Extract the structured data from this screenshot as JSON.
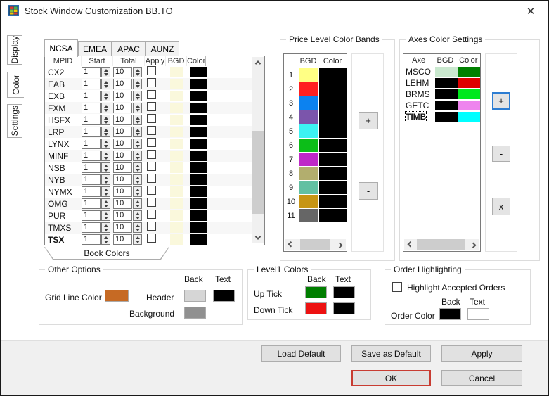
{
  "window": {
    "title": "Stock Window Customization BB.TO",
    "close_glyph": "✕"
  },
  "side_tabs": [
    {
      "label": "Display",
      "selected": false
    },
    {
      "label": "Color",
      "selected": true
    },
    {
      "label": "Settings",
      "selected": false
    }
  ],
  "region_tabs": [
    {
      "label": "NCSA",
      "selected": true
    },
    {
      "label": "EMEA",
      "selected": false
    },
    {
      "label": "APAC",
      "selected": false
    },
    {
      "label": "AUNZ",
      "selected": false
    }
  ],
  "book_table": {
    "headers": [
      "MPID",
      "Start",
      "Total",
      "Apply",
      "BGD",
      "Color"
    ],
    "row_defaults": {
      "start": "1",
      "total": "10",
      "apply": false,
      "bgd": "#FAF8DC",
      "color": "#000000"
    },
    "rows": [
      {
        "mpid": "CX2"
      },
      {
        "mpid": "EAB"
      },
      {
        "mpid": "EXB"
      },
      {
        "mpid": "FXM"
      },
      {
        "mpid": "HSFX"
      },
      {
        "mpid": "LRP"
      },
      {
        "mpid": "LYNX"
      },
      {
        "mpid": "MINF"
      },
      {
        "mpid": "NSB"
      },
      {
        "mpid": "NYB"
      },
      {
        "mpid": "NYMX"
      },
      {
        "mpid": "OMG"
      },
      {
        "mpid": "PUR"
      },
      {
        "mpid": "TMXS"
      },
      {
        "mpid": "TSX",
        "bold": true
      }
    ],
    "bottom_tab": "Book Colors"
  },
  "price_bands": {
    "title": "Price Level Color Bands",
    "headers": [
      "BGD",
      "Color"
    ],
    "rows": [
      {
        "n": "1",
        "bgd": "#FFFF84",
        "color": "#000000"
      },
      {
        "n": "2",
        "bgd": "#FF2020",
        "color": "#000000"
      },
      {
        "n": "3",
        "bgd": "#0C82F0",
        "color": "#000000"
      },
      {
        "n": "4",
        "bgd": "#7B55AB",
        "color": "#000000"
      },
      {
        "n": "5",
        "bgd": "#3CF2F2",
        "color": "#000000"
      },
      {
        "n": "6",
        "bgd": "#0CBE18",
        "color": "#000000"
      },
      {
        "n": "7",
        "bgd": "#BE29C8",
        "color": "#000000"
      },
      {
        "n": "8",
        "bgd": "#B2AE6E",
        "color": "#000000"
      },
      {
        "n": "9",
        "bgd": "#62C0A2",
        "color": "#000000"
      },
      {
        "n": "10",
        "bgd": "#C79514",
        "color": "#000000"
      },
      {
        "n": "11",
        "bgd": "#666666",
        "color": "#000000"
      }
    ],
    "add_label": "+",
    "remove_label": "-"
  },
  "axes": {
    "title": "Axes Color Settings",
    "headers": [
      "Axe",
      "BGD",
      "Color"
    ],
    "rows": [
      {
        "axe": "MSCO",
        "bgd": "#C9E8CE",
        "color": "#008000"
      },
      {
        "axe": "LEHM",
        "bgd": "#000000",
        "color": "#DE0000"
      },
      {
        "axe": "BRMS",
        "bgd": "#000000",
        "color": "#00E81C"
      },
      {
        "axe": "GETC",
        "bgd": "#000000",
        "color": "#EE84EE"
      },
      {
        "axe": "TIMB",
        "bgd": "#000000",
        "color": "#00FFFF",
        "bold": true,
        "focused": true
      }
    ],
    "add_label": "+",
    "remove_label": "-",
    "delete_label": "x"
  },
  "other_options": {
    "title": "Other Options",
    "back_header": "Back",
    "text_header": "Text",
    "grid_line_label": "Grid Line Color",
    "grid_line_color": "#C66A24",
    "header_label": "Header",
    "header_back": "#D6D6D6",
    "header_text": "#000000",
    "background_label": "Background",
    "background_color": "#909090"
  },
  "level1": {
    "title": "Level1 Colors",
    "back_header": "Back",
    "text_header": "Text",
    "up_tick_label": "Up Tick",
    "up_tick_back": "#007E00",
    "up_tick_text": "#000000",
    "down_tick_label": "Down Tick",
    "down_tick_back": "#ED1111",
    "down_tick_text": "#000000"
  },
  "order_highlighting": {
    "title": "Order Highlighting",
    "checkbox_label": "Highlight Accepted Orders",
    "checked": false,
    "back_header": "Back",
    "text_header": "Text",
    "order_color_label": "Order Color",
    "order_back": "#000000",
    "order_text": "#FFFFFF"
  },
  "footer_buttons": {
    "load_default": "Load Default",
    "save_as_default": "Save as Default",
    "apply": "Apply",
    "ok": "OK",
    "cancel": "Cancel"
  }
}
